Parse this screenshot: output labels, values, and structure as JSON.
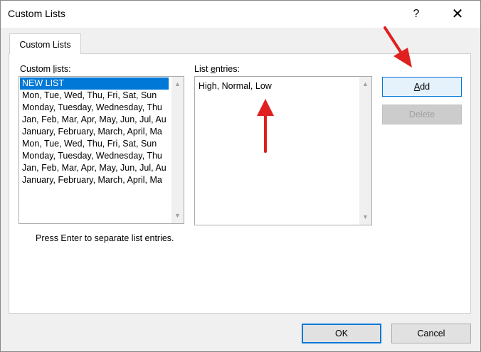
{
  "window": {
    "title": "Custom Lists",
    "help_glyph": "?",
    "close_glyph": "✕"
  },
  "tabs": [
    {
      "label": "Custom Lists"
    }
  ],
  "custom_lists": {
    "label_prefix": "Custom ",
    "label_accel": "l",
    "label_suffix": "ists:",
    "items": [
      {
        "label": "NEW LIST",
        "selected": true
      },
      {
        "label": "Mon, Tue, Wed, Thu, Fri, Sat, Sun"
      },
      {
        "label": "Monday, Tuesday, Wednesday, Thu"
      },
      {
        "label": "Jan, Feb, Mar, Apr, May, Jun, Jul, Au"
      },
      {
        "label": "January, February, March, April, Ma"
      },
      {
        "label": "Mon, Tue, Wed, Thu, Fri, Sat, Sun"
      },
      {
        "label": "Monday, Tuesday, Wednesday, Thu"
      },
      {
        "label": "Jan, Feb, Mar, Apr, May, Jun, Jul, Au"
      },
      {
        "label": "January, February, March, April, Ma"
      }
    ]
  },
  "list_entries": {
    "label_prefix": "List ",
    "label_accel": "e",
    "label_suffix": "ntries:",
    "value": "High, Normal, Low"
  },
  "buttons": {
    "add_accel": "A",
    "add_rest": "dd",
    "delete": "Delete",
    "ok": "OK",
    "cancel": "Cancel"
  },
  "hint": "Press Enter to separate list entries.",
  "colors": {
    "selection": "#0078d7",
    "arrow": "#e02020"
  }
}
